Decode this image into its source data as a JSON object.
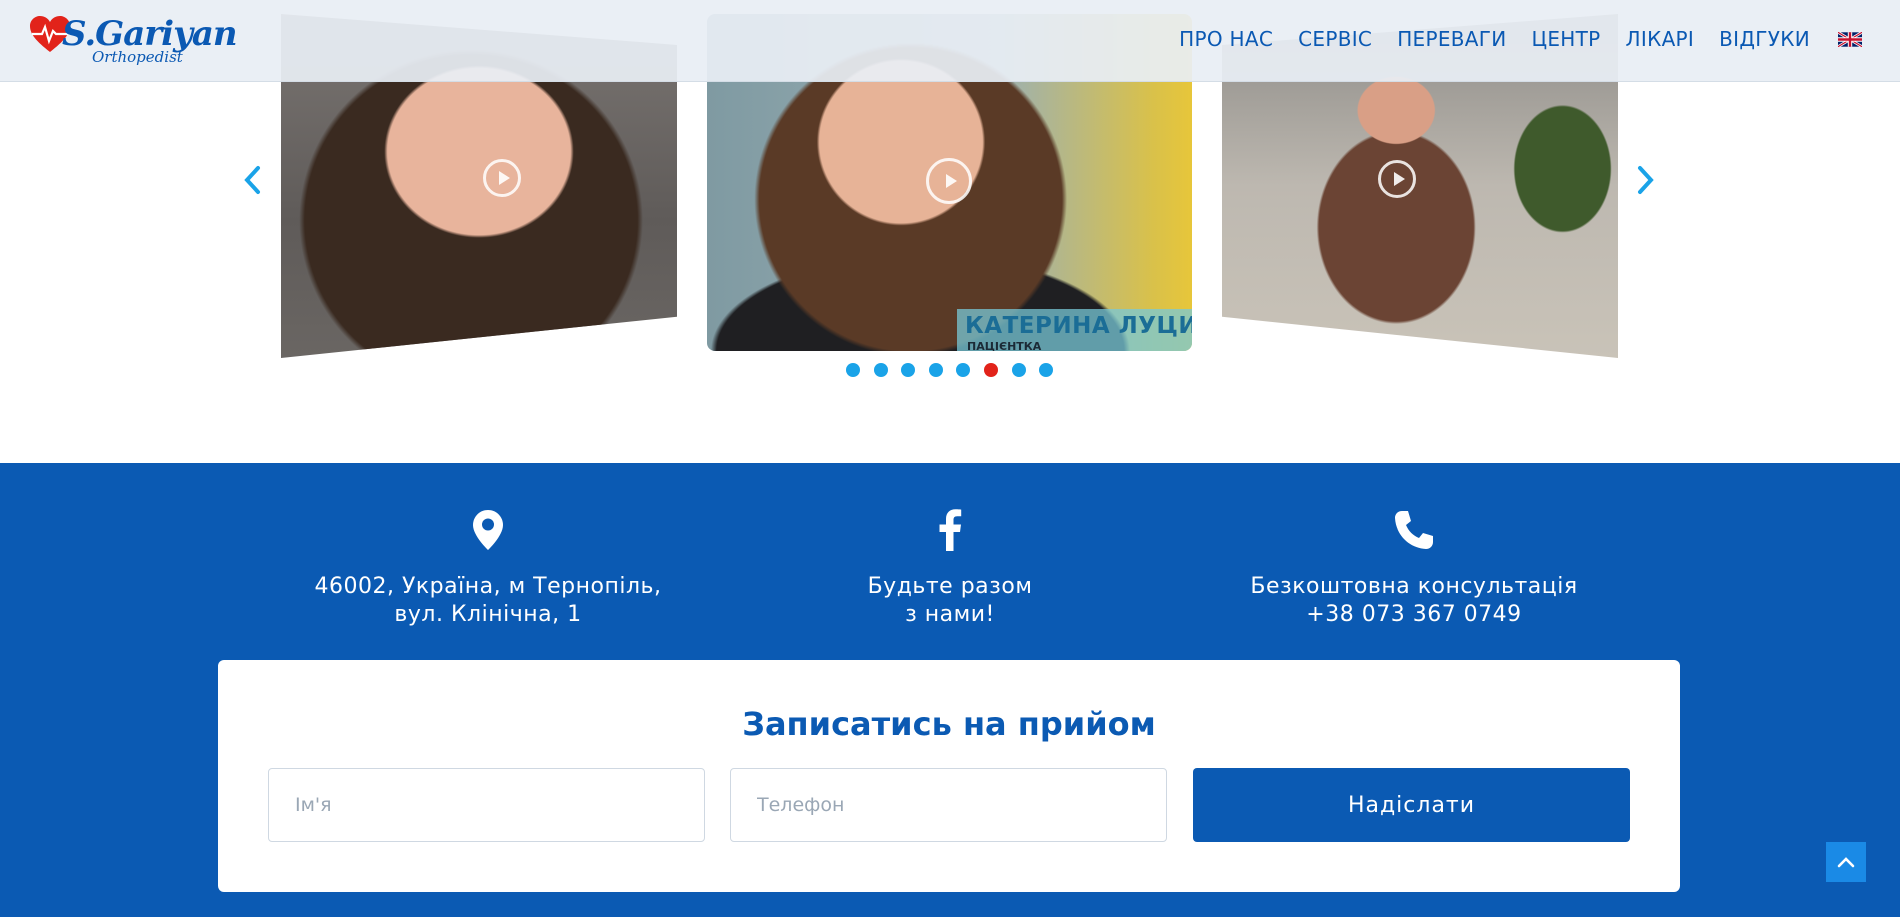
{
  "brand": {
    "name": "S.Gariyan",
    "subtitle": "Orthopedist",
    "colors": {
      "primary": "#0b5ab3",
      "accent_red": "#e2231a",
      "dot": "#1aa3e8"
    }
  },
  "nav": {
    "items": [
      {
        "label": "ПРО НАС"
      },
      {
        "label": "СЕРВІС"
      },
      {
        "label": "ПЕРЕВАГИ"
      },
      {
        "label": "ЦЕНТР"
      },
      {
        "label": "ЛІКАРІ"
      },
      {
        "label": "ВІДГУКИ"
      }
    ],
    "language_icon": "uk-flag-icon"
  },
  "carousel": {
    "slides": [
      {
        "position": "left",
        "icon": "play-icon"
      },
      {
        "position": "center",
        "icon": "play-icon",
        "caption": "КАТЕРИНА ЛУЦИ",
        "caption_sub": "ПАЦІЄНТКА"
      },
      {
        "position": "right",
        "icon": "play-icon"
      }
    ],
    "prev_icon": "chevron-left-icon",
    "next_icon": "chevron-right-icon",
    "dots_count": 8,
    "active_dot_index": 5
  },
  "contacts": {
    "address": {
      "icon": "location-pin-icon",
      "line1": "46002, Україна, м Тернопіль,",
      "line2": "вул. Клінічна, 1"
    },
    "social": {
      "icon": "facebook-icon",
      "line1": "Будьте разом",
      "line2": "з нами!"
    },
    "phone": {
      "icon": "phone-icon",
      "line1": "Безкоштовна консультація",
      "line2": "+38 073 367 0749"
    }
  },
  "form": {
    "title": "Записатись на прийом",
    "name_placeholder": "Ім'я",
    "phone_placeholder": "Телефон",
    "submit_label": "Надіслати"
  },
  "scroll_top_icon": "chevron-up-icon"
}
